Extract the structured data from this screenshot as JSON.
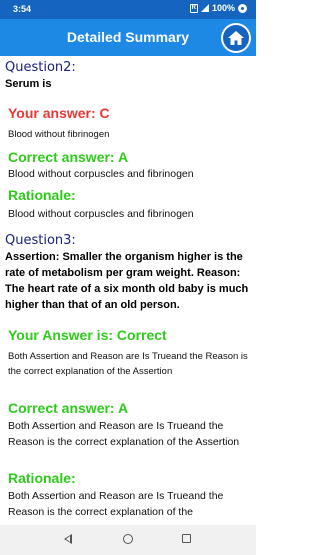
{
  "status_bar": {
    "time": "3:54",
    "sim_label": "R",
    "battery": "100%"
  },
  "app_bar": {
    "title": "Detailed Summary",
    "home_icon": "home-icon"
  },
  "questions": [
    {
      "label": "Question2:",
      "text": "Serum is",
      "your_answer_heading": "Your answer: C",
      "your_answer_text": "Blood without fibrinogen",
      "correct_heading": "Correct answer: A",
      "correct_text": "Blood without corpuscles and fibrinogen",
      "rationale_heading": "Rationale:",
      "rationale_text": "Blood without corpuscles and fibrinogen"
    },
    {
      "label": "Question3:",
      "text": "Assertion: Smaller the organism higher is the rate of metabolism per gram weight. Reason: The heart rate of a six month old baby is much higher than that of an old person.",
      "your_answer_heading": "Your Answer is: Correct",
      "your_answer_text": "Both Assertion and Reason are Is Trueand the Reason is the correct explanation of the Assertion",
      "correct_heading": "Correct answer: A",
      "correct_text": "Both Assertion and Reason are Is Trueand the Reason is the correct explanation of the Assertion",
      "rationale_heading": "Rationale:",
      "rationale_text": "Both Assertion and Reason are Is Trueand the Reason is the correct explanation of the"
    }
  ],
  "colors": {
    "status_bar": "#1565c0",
    "app_bar": "#1e88e5",
    "wrong": "#e53935",
    "correct": "#2ecc1a",
    "question_label": "#1a237e"
  },
  "nav_bar": {
    "back_icon": "back-triangle-icon",
    "home_icon": "home-circle-icon",
    "recents_icon": "recents-square-icon"
  }
}
